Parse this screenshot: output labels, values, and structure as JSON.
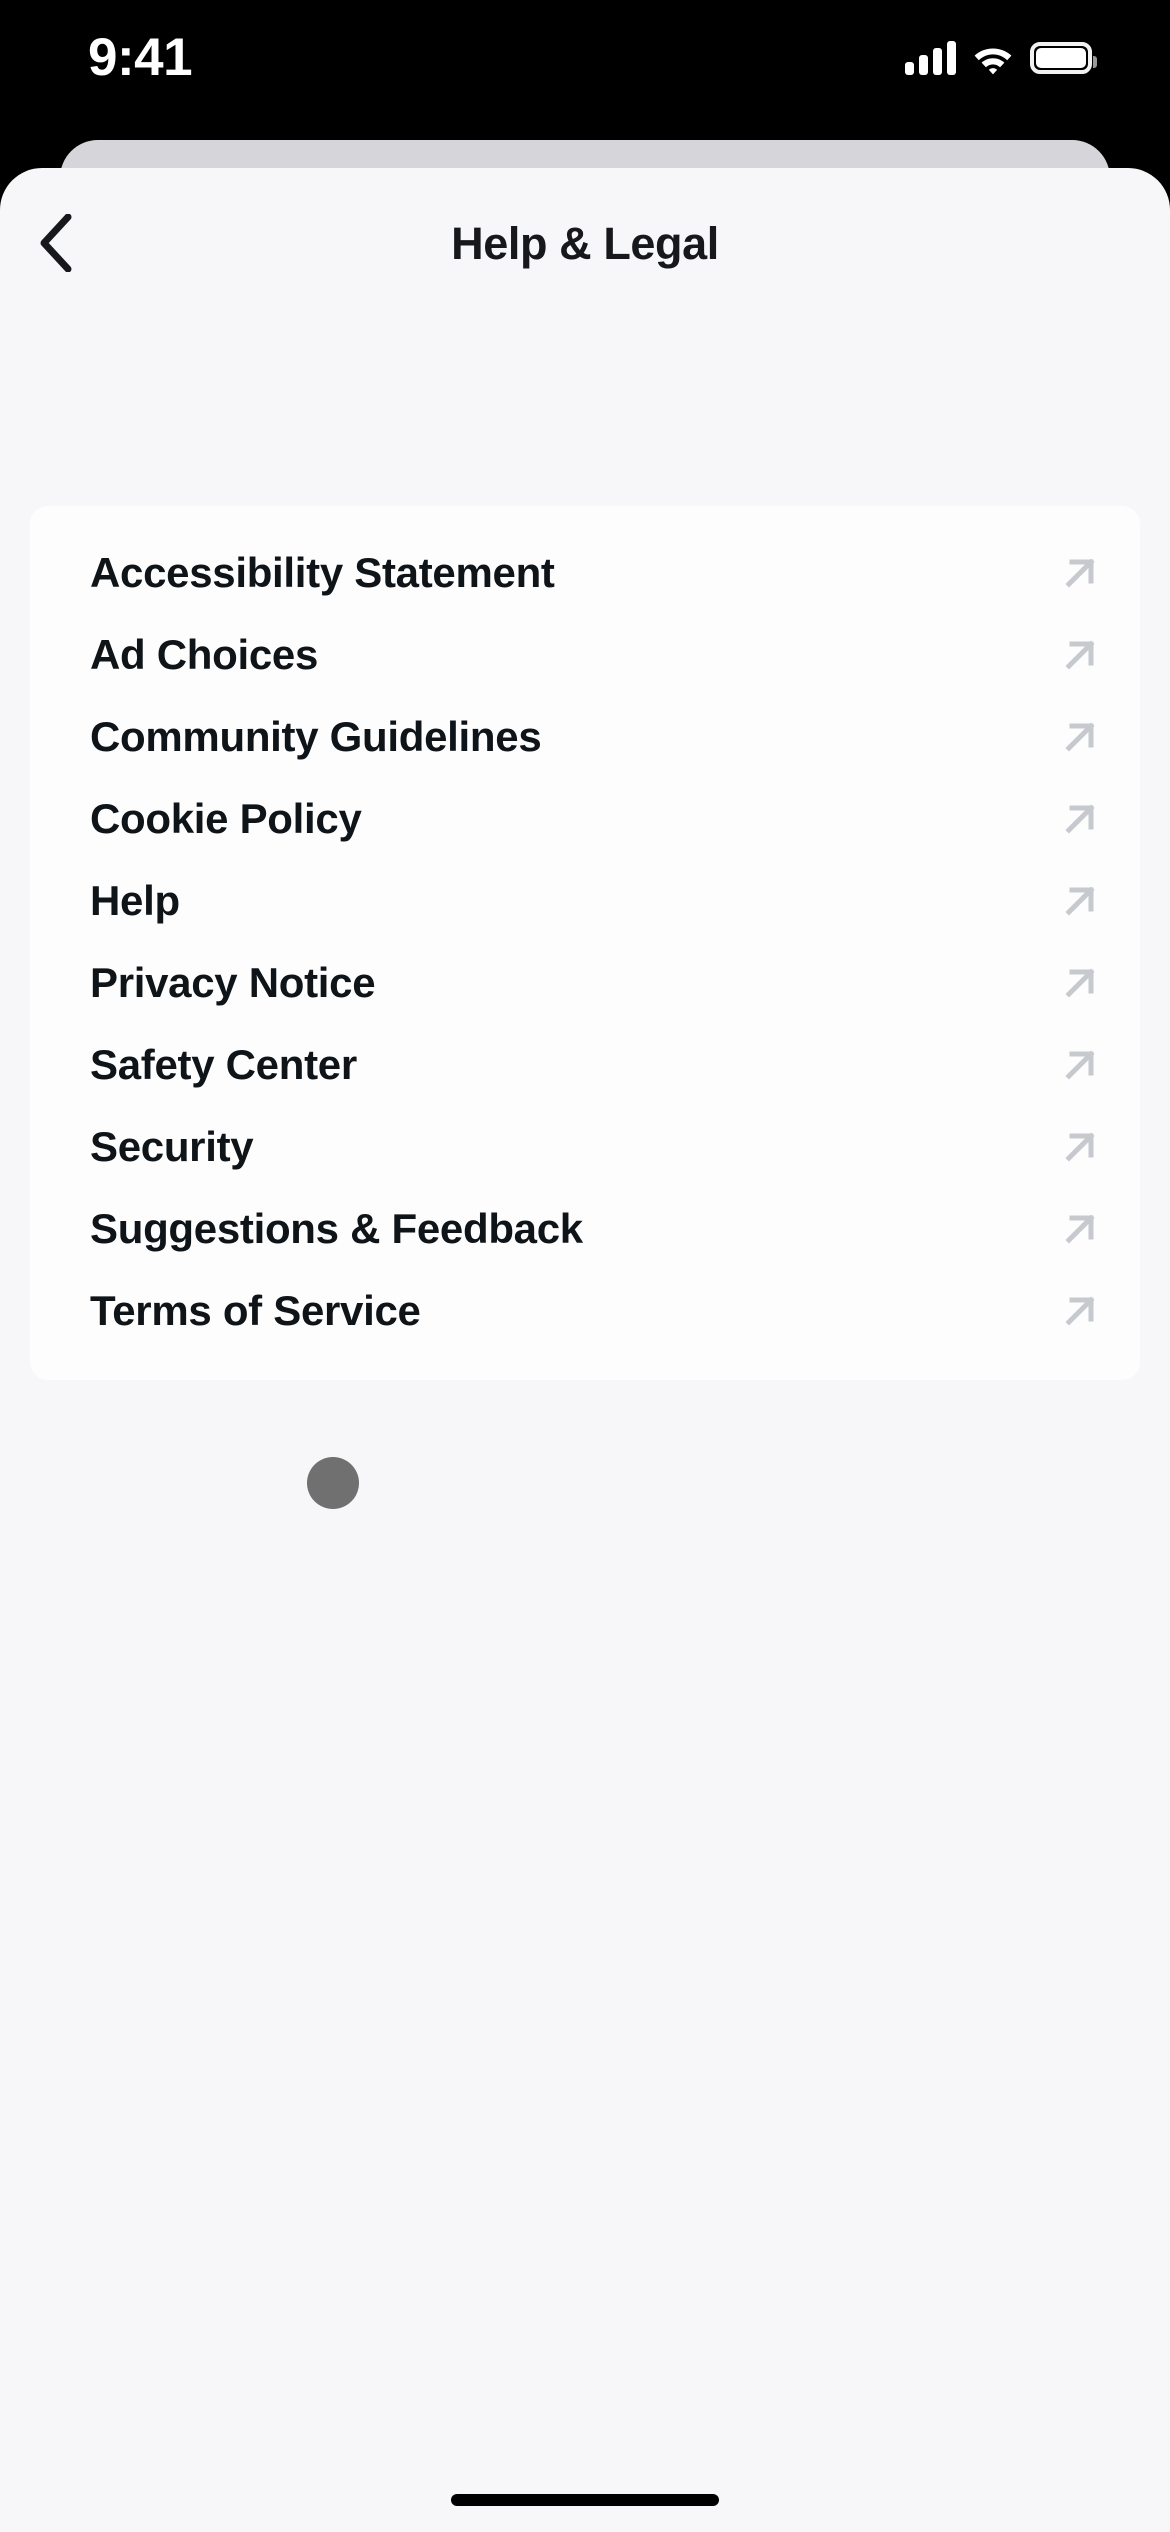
{
  "status_bar": {
    "time": "9:41",
    "cellular_icon": "cellular-signal-icon",
    "wifi_icon": "wifi-icon",
    "battery_icon": "battery-icon",
    "battery_level_percent": 100
  },
  "nav": {
    "back_icon": "chevron-left-icon",
    "title": "Help & Legal"
  },
  "list": {
    "external_link_icon": "external-link-arrow-icon",
    "items": [
      {
        "label": "Accessibility Statement"
      },
      {
        "label": "Ad Choices"
      },
      {
        "label": "Community Guidelines"
      },
      {
        "label": "Cookie Policy"
      },
      {
        "label": "Help"
      },
      {
        "label": "Privacy Notice"
      },
      {
        "label": "Safety Center"
      },
      {
        "label": "Security"
      },
      {
        "label": "Suggestions & Feedback"
      },
      {
        "label": "Terms of Service"
      }
    ]
  },
  "overlay": {
    "tap_indicator": "touch-point-indicator",
    "tap_target_label": "Suggestions & Feedback"
  },
  "home_indicator": "home-indicator-bar",
  "colors": {
    "screen_background": "#000000",
    "sheet_background": "#F7F7FA",
    "sheet_stack_behind": "#D6D5D9",
    "card_background": "#FDFDFE",
    "primary_text": "#0F1419",
    "title_text": "#16181C",
    "icon_gray": "#C6C9CE",
    "status_icon": "#FFFFFF",
    "tap_indicator": "#3C3C3C"
  }
}
